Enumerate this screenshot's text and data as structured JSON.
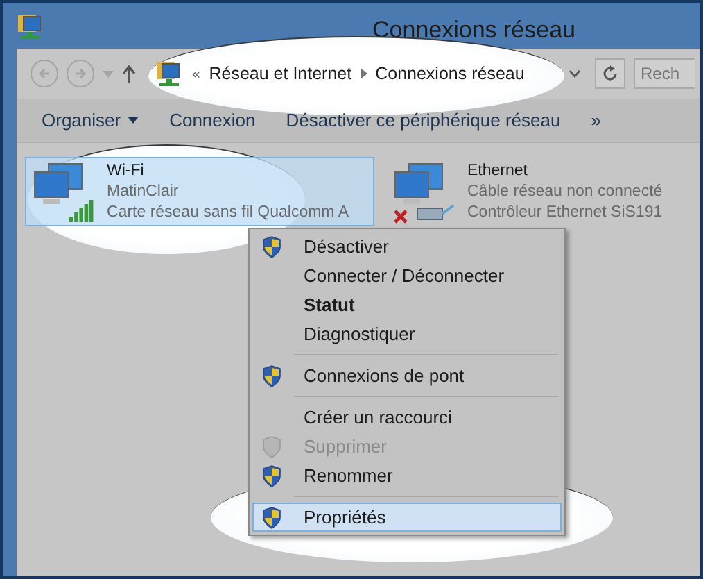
{
  "window": {
    "title": "Connexions réseau"
  },
  "address_bar": {
    "overflow": "«",
    "breadcrumbs": [
      "Réseau et Internet",
      "Connexions réseau"
    ]
  },
  "search": {
    "placeholder": "Rech"
  },
  "command_bar": [
    {
      "label": "Organiser",
      "dropdown": true
    },
    {
      "label": "Connexion",
      "dropdown": false
    },
    {
      "label": "Désactiver ce périphérique réseau",
      "dropdown": false
    },
    {
      "label": "»",
      "dropdown": false
    }
  ],
  "connections": [
    {
      "kind": "wifi",
      "name": "Wi-Fi",
      "status": "MatinClair",
      "adapter": "Carte réseau sans fil Qualcomm A",
      "selected": true
    },
    {
      "kind": "ethernet",
      "name": "Ethernet",
      "status": "Câble réseau non connecté",
      "adapter": "Contrôleur Ethernet SiS191",
      "selected": false
    }
  ],
  "context_menu": [
    {
      "kind": "item",
      "label": "Désactiver",
      "shield": true,
      "default": false,
      "disabled": false,
      "selected": false
    },
    {
      "kind": "item",
      "label": "Connecter / Déconnecter",
      "shield": false,
      "default": false,
      "disabled": false,
      "selected": false
    },
    {
      "kind": "item",
      "label": "Statut",
      "shield": false,
      "default": true,
      "disabled": false,
      "selected": false
    },
    {
      "kind": "item",
      "label": "Diagnostiquer",
      "shield": false,
      "default": false,
      "disabled": false,
      "selected": false
    },
    {
      "kind": "separator"
    },
    {
      "kind": "item",
      "label": "Connexions de pont",
      "shield": true,
      "default": false,
      "disabled": false,
      "selected": false
    },
    {
      "kind": "separator"
    },
    {
      "kind": "item",
      "label": "Créer un raccourci",
      "shield": false,
      "default": false,
      "disabled": false,
      "selected": false
    },
    {
      "kind": "item",
      "label": "Supprimer",
      "shield": true,
      "default": false,
      "disabled": true,
      "selected": false
    },
    {
      "kind": "item",
      "label": "Renommer",
      "shield": true,
      "default": false,
      "disabled": false,
      "selected": false
    },
    {
      "kind": "separator"
    },
    {
      "kind": "item",
      "label": "Propriétés",
      "shield": true,
      "default": false,
      "disabled": false,
      "selected": true
    }
  ]
}
